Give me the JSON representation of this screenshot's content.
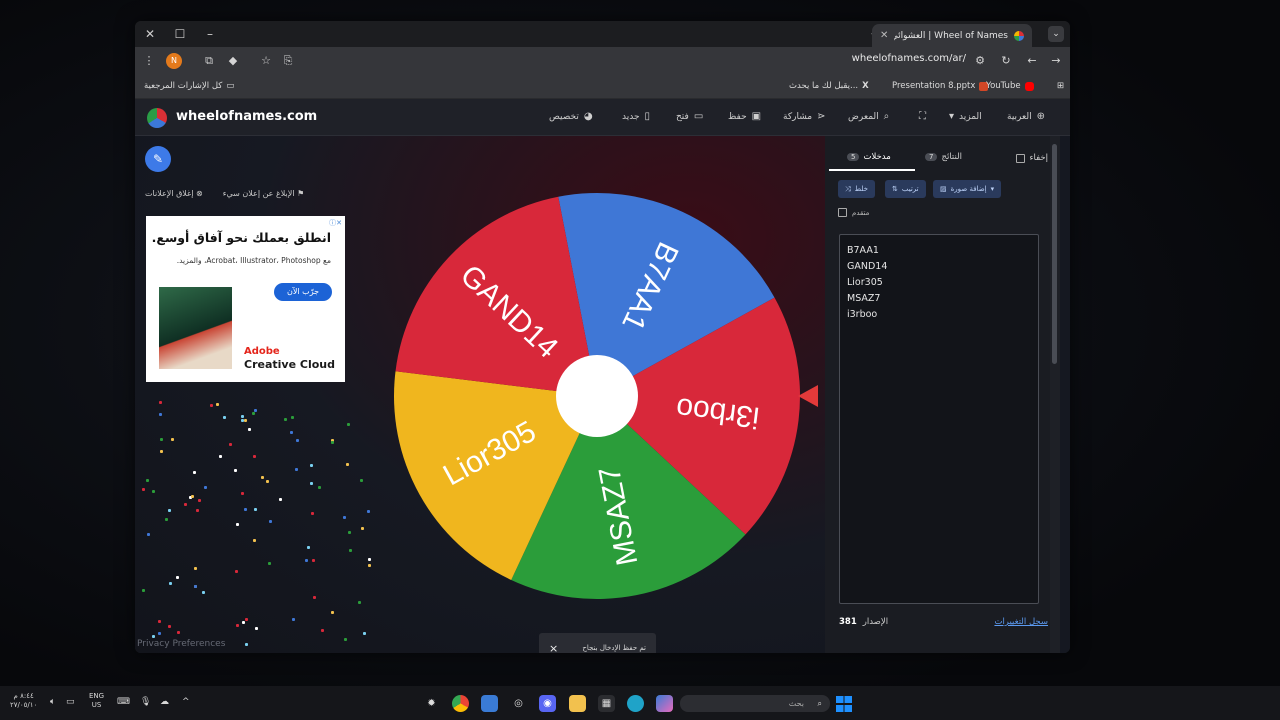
{
  "browser": {
    "tab_title": "Wheel of Names | العشوائي",
    "url": "wheelofnames.com/ar/",
    "profile_initial": "N",
    "bookmarks": [
      {
        "label": "YouTube",
        "color": "#ff0000"
      },
      {
        "label": "Presentation 8.pptx",
        "color": "#d24726"
      },
      {
        "label": "يقبل لك ما يحدث...",
        "color": "#ffffff"
      },
      {
        "label": "كل الإشارات المرجعية",
        "color": "#cfcfcf"
      }
    ]
  },
  "app": {
    "logo_text": "wheelofnames.com",
    "nav": {
      "language": "العربية",
      "more": "المزيد",
      "gallery": "المعرض",
      "share": "مشاركة",
      "save": "حفظ",
      "open": "فتح",
      "new": "جديد",
      "customize": "تخصيص"
    }
  },
  "stage": {
    "report_ad": "الإبلاغ عن إعلان سيء",
    "close_ads": "إغلاق الإعلانات",
    "privacy": "Privacy Preferences"
  },
  "ad": {
    "headline": "انطلق بعملك نحو آفاق أوسع.",
    "subtext": "مع Acrobat، Illustrator، Photoshop، والمزيد.",
    "cta": "جرّب الآن",
    "brand_line1": "Adobe",
    "brand_line2": "Creative Cloud"
  },
  "wheel": {
    "slices": [
      {
        "label": "B7AA1",
        "color": "#3f77d6"
      },
      {
        "label": "i3rboo",
        "color": "#d8283a"
      },
      {
        "label": "MSAZ7",
        "color": "#2b9d3a"
      },
      {
        "label": "Lior305",
        "color": "#f0b61e"
      },
      {
        "label": "GAND14",
        "color": "#d8283a"
      }
    ],
    "pointer_color": "#e33a3a"
  },
  "toast": {
    "text": "تم حفظ الإدخال بنجاح",
    "close": "×"
  },
  "panel": {
    "tab_entries": "مدخلات",
    "entries_count": "5",
    "tab_results": "النتائج",
    "results_count": "7",
    "hide": "إخفاء",
    "btn_shuffle": "خلط",
    "btn_sort": "ترتيب",
    "btn_add_image": "إضافة صورة",
    "advanced": "متقدم",
    "entries": [
      "B7AA1",
      "GAND14",
      "Lior305",
      "MSAZ7",
      "i3rboo"
    ],
    "version_label": "الإصدار",
    "version_number": "381",
    "changelog": "سجل التغييرات"
  },
  "taskbar": {
    "search_placeholder": "بحث",
    "lang_top": "ENG",
    "lang_bottom": "US",
    "time": "٨:٤٤ م",
    "date": "٢٧/٠٥/١٠"
  }
}
